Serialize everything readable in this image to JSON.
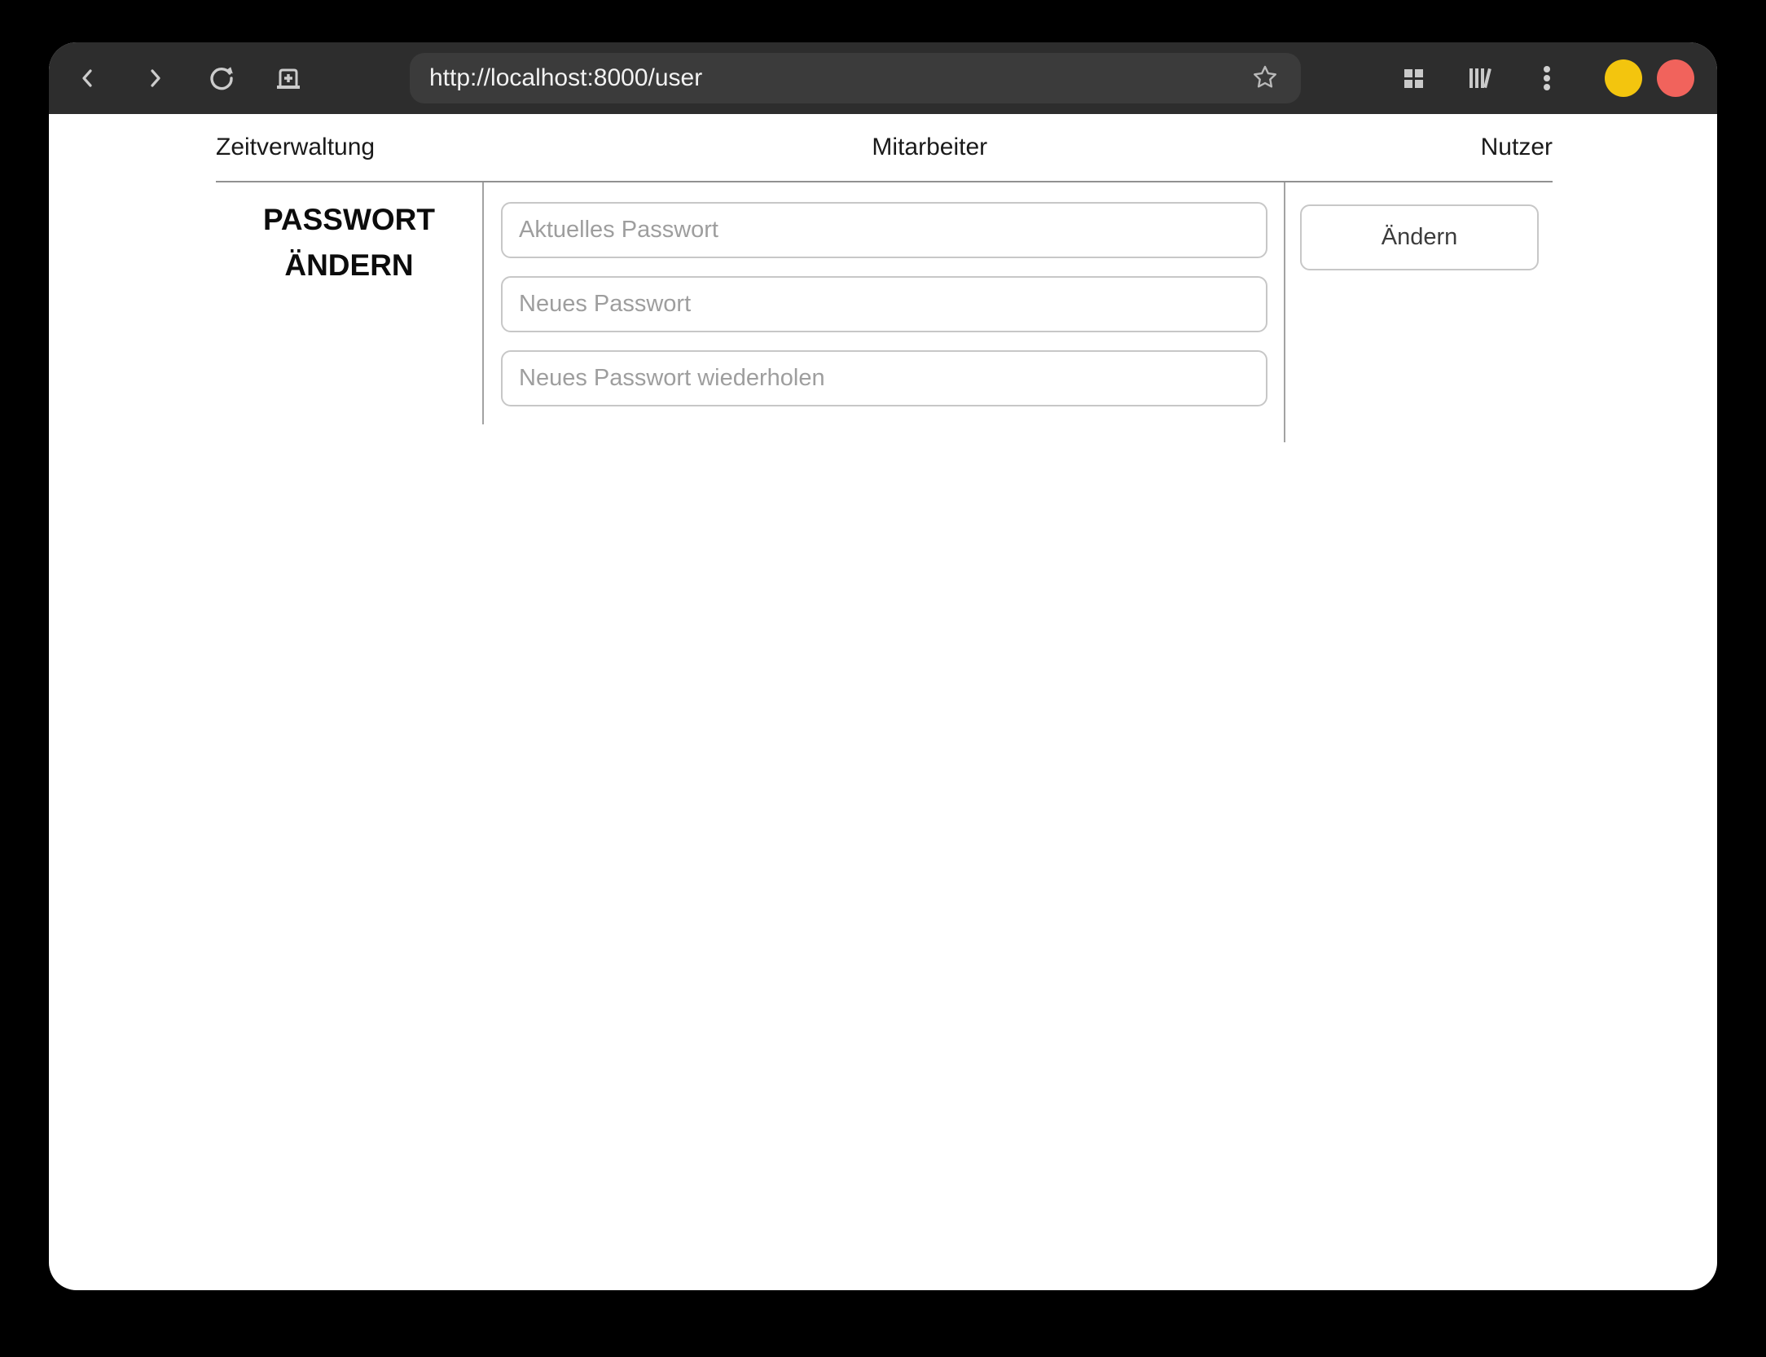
{
  "browser": {
    "url": "http://localhost:8000/user",
    "icons": {
      "back": "‹",
      "forward": "›",
      "reload": "⟳",
      "new_tab": "⊞",
      "bookmark": "☆",
      "tab_overview": "▦",
      "library": "▥",
      "menu": "⋮"
    },
    "window_controls": {
      "minimize_color": "#f3c50e",
      "close_color": "#f1635c"
    },
    "colors": {
      "headerbar_bg": "#2d2d2d",
      "urlbar_bg": "#3b3b3b",
      "icon_color": "#cccccc"
    }
  },
  "nav": {
    "items": [
      {
        "label": "Zeitverwaltung"
      },
      {
        "label": "Mitarbeiter"
      },
      {
        "label": "Nutzer"
      }
    ]
  },
  "form": {
    "title_line1": "PASSWORT",
    "title_line2": "ÄNDERN",
    "fields": [
      {
        "placeholder": "Aktuelles Passwort"
      },
      {
        "placeholder": "Neues Passwort"
      },
      {
        "placeholder": "Neues Passwort wiederholen"
      }
    ],
    "submit_label": "Ändern"
  },
  "page_colors": {
    "divider": "#a2a2a2",
    "rule": "#919191",
    "placeholder": "#9e9e9e"
  }
}
